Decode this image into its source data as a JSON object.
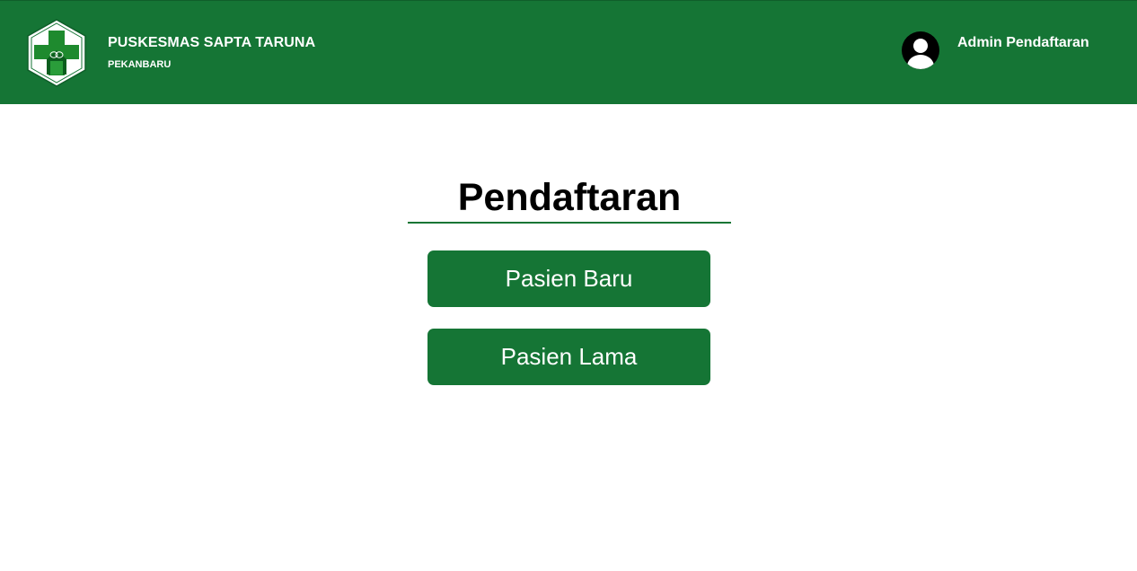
{
  "header": {
    "brand_title": "PUSKESMAS SAPTA TARUNA",
    "brand_subtitle": "PEKANBARU",
    "user_name": "Admin Pendaftaran",
    "logo_icon": "puskesmas-logo-icon",
    "avatar_icon": "user-avatar-icon"
  },
  "main": {
    "title": "Pendaftaran",
    "buttons": [
      {
        "label": "Pasien Baru"
      },
      {
        "label": "Pasien Lama"
      }
    ]
  },
  "colors": {
    "primary": "#157535",
    "logo_green": "#1e8a2e",
    "text_dark": "#000000",
    "white": "#ffffff"
  }
}
